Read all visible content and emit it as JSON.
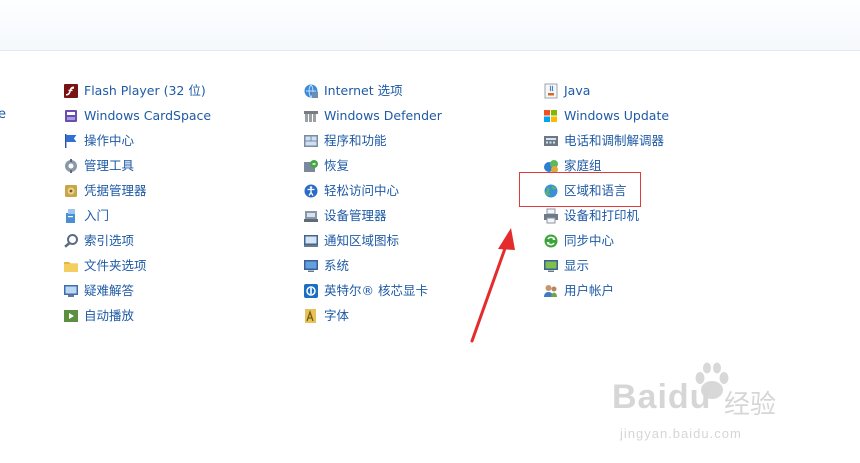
{
  "partial_left_text": "e",
  "columns": [
    [
      {
        "label": "Flash Player (32 位)",
        "icon": "flash-icon"
      },
      {
        "label": "Windows CardSpace",
        "icon": "cardspace-icon"
      },
      {
        "label": "操作中心",
        "icon": "flag-icon"
      },
      {
        "label": "管理工具",
        "icon": "tools-icon"
      },
      {
        "label": "凭据管理器",
        "icon": "vault-icon"
      },
      {
        "label": "入门",
        "icon": "getting-started-icon"
      },
      {
        "label": "索引选项",
        "icon": "indexing-icon"
      },
      {
        "label": "文件夹选项",
        "icon": "folder-icon"
      },
      {
        "label": "疑难解答",
        "icon": "troubleshoot-icon"
      },
      {
        "label": "自动播放",
        "icon": "autoplay-icon"
      }
    ],
    [
      {
        "label": "Internet 选项",
        "icon": "internet-icon"
      },
      {
        "label": "Windows Defender",
        "icon": "defender-icon"
      },
      {
        "label": "程序和功能",
        "icon": "programs-icon"
      },
      {
        "label": "恢复",
        "icon": "recovery-icon"
      },
      {
        "label": "轻松访问中心",
        "icon": "accessibility-icon"
      },
      {
        "label": "设备管理器",
        "icon": "device-manager-icon"
      },
      {
        "label": "通知区域图标",
        "icon": "notification-icon"
      },
      {
        "label": "系统",
        "icon": "system-icon"
      },
      {
        "label": "英特尔® 核芯显卡",
        "icon": "intel-graphics-icon"
      },
      {
        "label": "字体",
        "icon": "fonts-icon"
      }
    ],
    [
      {
        "label": "Java",
        "icon": "java-icon"
      },
      {
        "label": "Windows Update",
        "icon": "windows-update-icon"
      },
      {
        "label": "电话和调制解调器",
        "icon": "phone-modem-icon"
      },
      {
        "label": "家庭组",
        "icon": "homegroup-icon"
      },
      {
        "label": "区域和语言",
        "icon": "region-language-icon"
      },
      {
        "label": "设备和打印机",
        "icon": "printer-icon"
      },
      {
        "label": "同步中心",
        "icon": "sync-icon"
      },
      {
        "label": "显示",
        "icon": "display-icon"
      },
      {
        "label": "用户帐户",
        "icon": "user-accounts-icon"
      }
    ]
  ],
  "watermark": {
    "brand": "Baidu",
    "cn": "经验",
    "url": "jingyan.baidu.com"
  },
  "colors": {
    "link": "#1e5aa6",
    "highlight": "#e03a3a",
    "arrow": "#e52c2c"
  }
}
